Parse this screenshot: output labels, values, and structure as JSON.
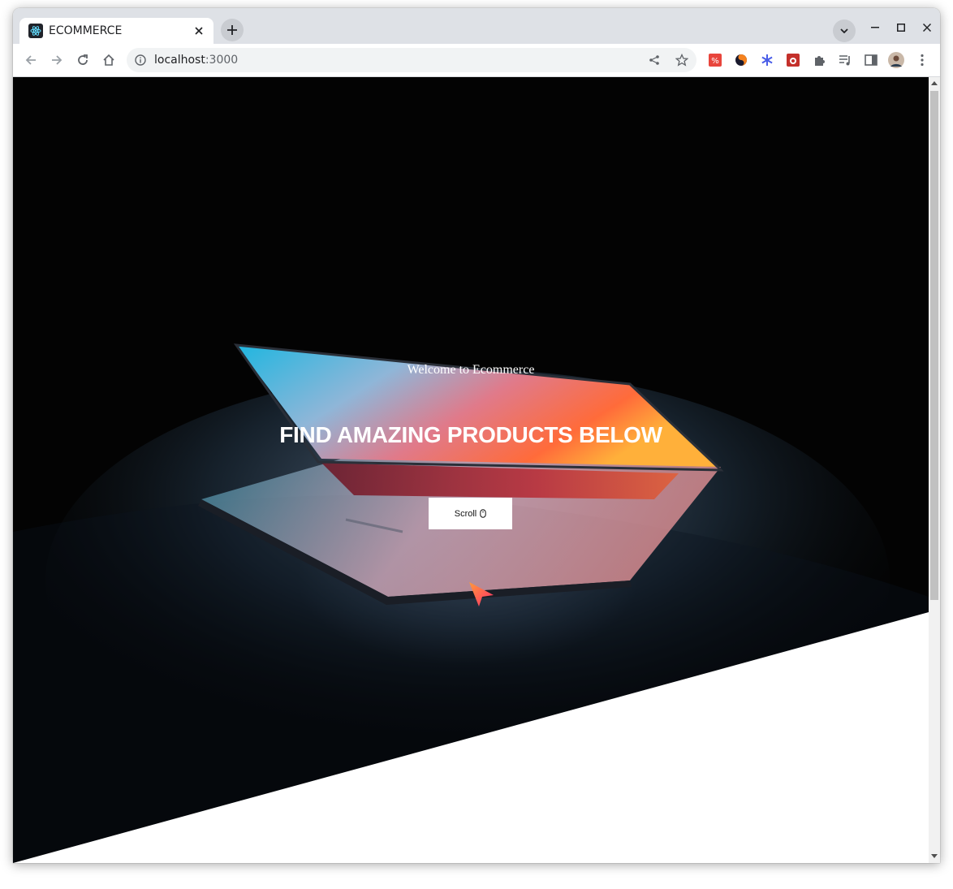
{
  "browser": {
    "tab": {
      "title": "ECOMMERCE",
      "favicon": "react-icon"
    },
    "url": {
      "host": "localhost",
      "port": ":3000"
    },
    "extensions": [
      "translate-extension-icon",
      "sync-extension-icon",
      "snowflake-extension-icon",
      "bug-extension-icon",
      "puzzle-extensions-icon",
      "reading-list-icon",
      "side-panel-icon",
      "profile-avatar-icon",
      "menu-icon"
    ]
  },
  "hero": {
    "welcome": "Welcome to Ecommerce",
    "headline": "FIND AMAZING PRODUCTS BELOW",
    "scroll_label": "Scroll"
  },
  "colors": {
    "hero_background": "#030303",
    "button_background": "#ffffff",
    "text": "#ffffff"
  }
}
